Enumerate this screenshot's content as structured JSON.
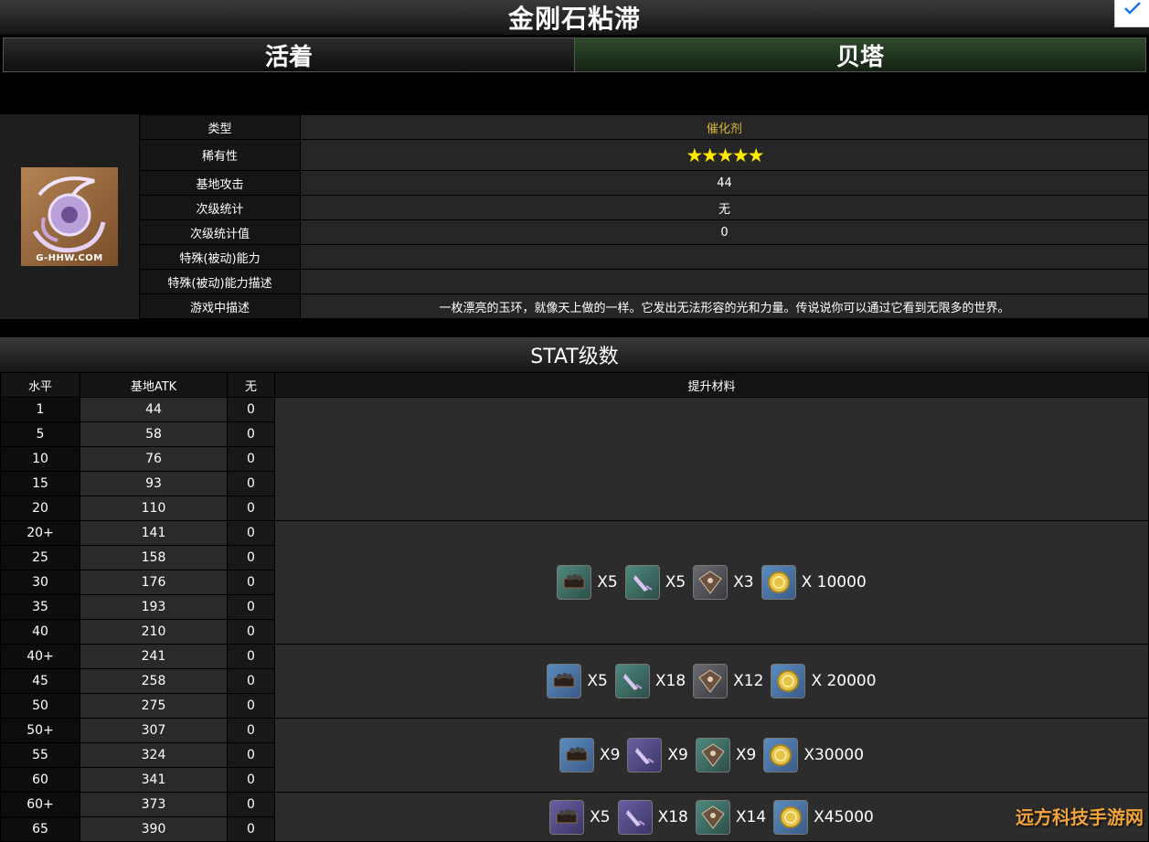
{
  "page": {
    "title": "金刚石粘滞"
  },
  "tabs": [
    {
      "label": "活着",
      "active": false
    },
    {
      "label": "贝塔",
      "active": true
    }
  ],
  "item_image": {
    "watermark": "G-HHW.COM",
    "icon": "jade-ring-icon"
  },
  "info": {
    "rows": [
      {
        "key": "类型",
        "value": "催化剂"
      },
      {
        "key": "稀有性",
        "value": "★★★★★"
      },
      {
        "key": "基地攻击",
        "value": "44"
      },
      {
        "key": "次级统计",
        "value": "无"
      },
      {
        "key": "次级统计值",
        "value": "0"
      },
      {
        "key": "特殊(被动)能力",
        "value": ""
      },
      {
        "key": "特殊(被动)能力描述",
        "value": ""
      },
      {
        "key": "游戏中描述",
        "value": "一枚漂亮的玉环，就像天上做的一样。它发出无法形容的光和力量。传说说你可以通过它看到无限多的世界。"
      }
    ],
    "rarity_stars": 5
  },
  "stats": {
    "title": "STAT级数",
    "headers": [
      "水平",
      "基地ATK",
      "无",
      "提升材料"
    ],
    "rows": [
      [
        "1",
        "44",
        "0"
      ],
      [
        "5",
        "58",
        "0"
      ],
      [
        "10",
        "76",
        "0"
      ],
      [
        "15",
        "93",
        "0"
      ],
      [
        "20",
        "110",
        "0"
      ],
      [
        "20+",
        "141",
        "0"
      ],
      [
        "25",
        "158",
        "0"
      ],
      [
        "30",
        "176",
        "0"
      ],
      [
        "35",
        "193",
        "0"
      ],
      [
        "40",
        "210",
        "0"
      ],
      [
        "40+",
        "241",
        "0"
      ],
      [
        "45",
        "258",
        "0"
      ],
      [
        "50",
        "275",
        "0"
      ],
      [
        "50+",
        "307",
        "0"
      ],
      [
        "55",
        "324",
        "0"
      ],
      [
        "60",
        "341",
        "0"
      ],
      [
        "60+",
        "373",
        "0"
      ],
      [
        "65",
        "390",
        "0"
      ]
    ],
    "material_groups": [
      {
        "rows": 5,
        "items": []
      },
      {
        "rows": 5,
        "items": [
          {
            "icon": "crate-icon",
            "tone": "teal",
            "count": "X5"
          },
          {
            "icon": "feather-icon",
            "tone": "teal",
            "count": "X5"
          },
          {
            "icon": "shield-icon",
            "tone": "grey",
            "count": "X3"
          },
          {
            "icon": "mora-coin-icon",
            "tone": "blue",
            "count": "X 10000"
          }
        ]
      },
      {
        "rows": 3,
        "items": [
          {
            "icon": "crate-icon",
            "tone": "blue",
            "count": "X5"
          },
          {
            "icon": "feather-icon",
            "tone": "teal",
            "count": "X18"
          },
          {
            "icon": "shield-icon",
            "tone": "grey",
            "count": "X12"
          },
          {
            "icon": "mora-coin-icon",
            "tone": "blue",
            "count": "X 20000"
          }
        ]
      },
      {
        "rows": 3,
        "items": [
          {
            "icon": "crate-icon",
            "tone": "blue",
            "count": "X9"
          },
          {
            "icon": "feather-icon",
            "tone": "purple",
            "count": "X9"
          },
          {
            "icon": "shield-icon",
            "tone": "teal",
            "count": "X9"
          },
          {
            "icon": "mora-coin-icon",
            "tone": "blue",
            "count": "X30000"
          }
        ]
      },
      {
        "rows": 2,
        "items": [
          {
            "icon": "crate-icon",
            "tone": "purple",
            "count": "X5"
          },
          {
            "icon": "feather-icon",
            "tone": "purple",
            "count": "X18"
          },
          {
            "icon": "shield-icon",
            "tone": "teal",
            "count": "X14"
          },
          {
            "icon": "mora-coin-icon",
            "tone": "blue",
            "count": "X45000"
          }
        ]
      }
    ]
  },
  "site_watermark": "远方科技手游网",
  "colors": {
    "accent_gold": "#d8b53a",
    "star": "#ffea00",
    "active_tab": "#2f4a2b"
  }
}
